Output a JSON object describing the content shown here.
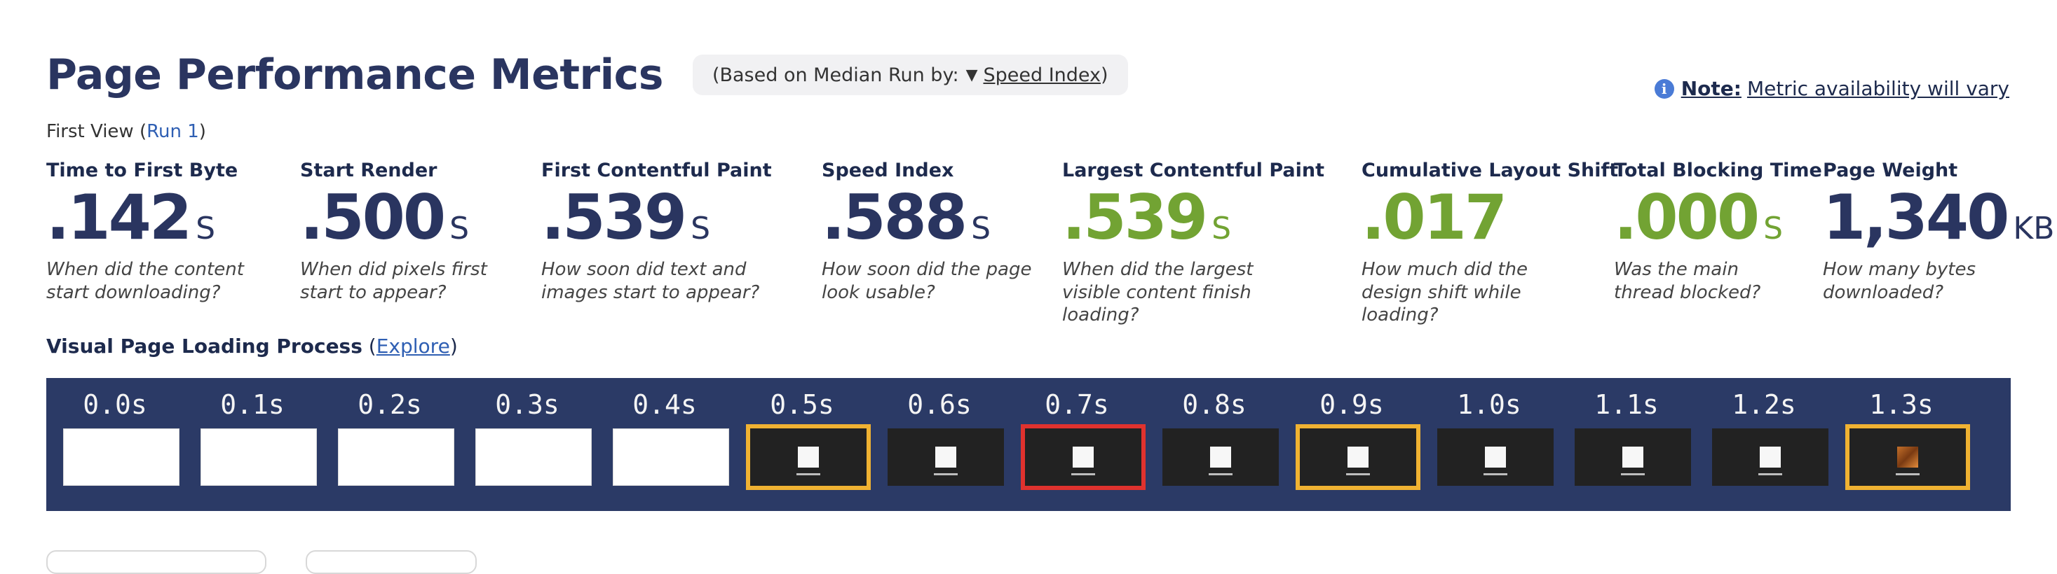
{
  "header": {
    "title": "Page Performance Metrics",
    "median_prefix": "(Based on Median Run by:",
    "median_metric": "Speed Index",
    "median_suffix": ")"
  },
  "note": {
    "label": "Note:",
    "text": "Metric availability will vary"
  },
  "first_view": {
    "prefix": "First View (",
    "run_link": "Run 1",
    "suffix": ")"
  },
  "metrics": [
    {
      "label": "Time to First Byte",
      "value": ".142",
      "unit": "S",
      "desc": "When did the content start downloading?",
      "status": "neutral"
    },
    {
      "label": "Start Render",
      "value": ".500",
      "unit": "S",
      "desc": "When did pixels first start to appear?",
      "status": "neutral"
    },
    {
      "label": "First Contentful Paint",
      "value": ".539",
      "unit": "S",
      "desc": "How soon did text and images start to appear?",
      "status": "neutral"
    },
    {
      "label": "Speed Index",
      "value": ".588",
      "unit": "S",
      "desc": "How soon did the page look usable?",
      "status": "neutral"
    },
    {
      "label": "Largest Contentful Paint",
      "value": ".539",
      "unit": "S",
      "desc": "When did the largest visible content finish loading?",
      "status": "good"
    },
    {
      "label": "Cumulative Layout Shift",
      "value": ".017",
      "unit": "",
      "desc": "How much did the design shift while loading?",
      "status": "good"
    },
    {
      "label": "Total Blocking Time",
      "value": ".000",
      "unit": "S",
      "desc": "Was the main thread blocked?",
      "status": "good"
    },
    {
      "label": "Page Weight",
      "value": "1,340",
      "unit": "KB",
      "desc": "How many bytes downloaded?",
      "status": "neutral"
    }
  ],
  "visual_loading": {
    "title": "Visual Page Loading Process",
    "open": "(",
    "explore": "Explore",
    "close": ")"
  },
  "filmstrip": [
    {
      "time": "0.0s",
      "state": "blank",
      "highlight": "none"
    },
    {
      "time": "0.1s",
      "state": "blank",
      "highlight": "none"
    },
    {
      "time": "0.2s",
      "state": "blank",
      "highlight": "none"
    },
    {
      "time": "0.3s",
      "state": "blank",
      "highlight": "none"
    },
    {
      "time": "0.4s",
      "state": "blank",
      "highlight": "none"
    },
    {
      "time": "0.5s",
      "state": "dark",
      "highlight": "yellow"
    },
    {
      "time": "0.6s",
      "state": "dark",
      "highlight": "none"
    },
    {
      "time": "0.7s",
      "state": "dark",
      "highlight": "red"
    },
    {
      "time": "0.8s",
      "state": "dark",
      "highlight": "none"
    },
    {
      "time": "0.9s",
      "state": "dark",
      "highlight": "yellow"
    },
    {
      "time": "1.0s",
      "state": "dark",
      "highlight": "none"
    },
    {
      "time": "1.1s",
      "state": "dark",
      "highlight": "none"
    },
    {
      "time": "1.2s",
      "state": "dark",
      "highlight": "none"
    },
    {
      "time": "1.3s",
      "state": "image",
      "highlight": "yellow"
    }
  ],
  "colors": {
    "navy": "#2a3560",
    "good_green": "#72a333",
    "link_blue": "#2f5fb3",
    "filmstrip_bg": "#2b3a66",
    "highlight_yellow": "#f0b232",
    "highlight_red": "#e0322e"
  }
}
